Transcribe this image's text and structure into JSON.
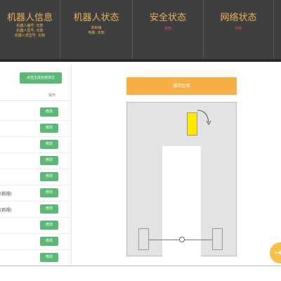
{
  "header": {
    "robot_info": {
      "title": "机器人信息",
      "lines": [
        "机器人编号: 无数",
        "机器人型号: 无数",
        "机器人类型号: 无数"
      ]
    },
    "robot_status": {
      "title": "机器人状态",
      "lines": [
        "未就绪",
        "电量: 未知"
      ]
    },
    "safety_status": {
      "title": "安全状态",
      "value": "未知"
    },
    "network_status": {
      "title": "网络状态",
      "value": "未知"
    }
  },
  "left_panel": {
    "generate_button": "点击生成全部货位",
    "ops_header": "操作",
    "rows": [
      {
        "label": "",
        "action": "修改"
      },
      {
        "label": "",
        "action": "修改"
      },
      {
        "label": "",
        "action": "修改"
      },
      {
        "label": "",
        "action": "修改"
      },
      {
        "label": "",
        "action": "修改"
      },
      {
        "label": "(前视)",
        "action": "修改"
      },
      {
        "label": "(前视)",
        "action": "修改"
      },
      {
        "label": "",
        "action": "修改"
      },
      {
        "label": "",
        "action": "修改"
      },
      {
        "label": "",
        "action": "修改"
      }
    ]
  },
  "map": {
    "banner": "缓存区域",
    "banner_color": "#f7ae47",
    "cart_color": "#ffea00"
  },
  "fab": {
    "icon": "arrow-right-icon",
    "glyph": "→",
    "color": "#f7c04a"
  }
}
